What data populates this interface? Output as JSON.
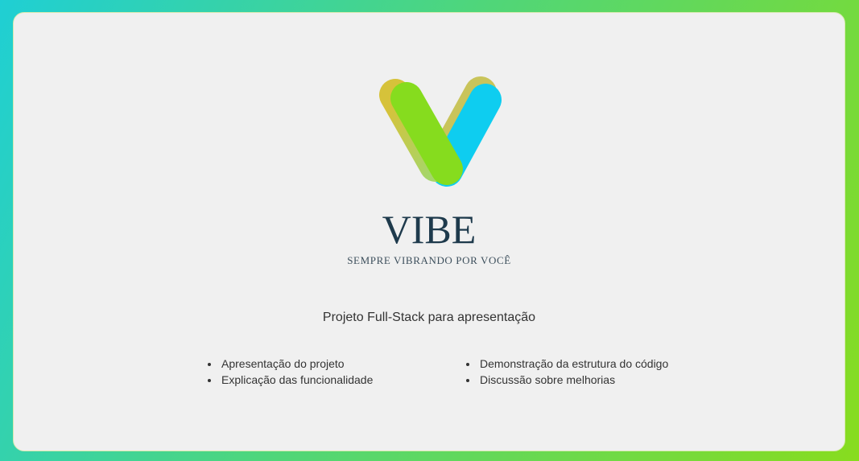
{
  "brand": {
    "name": "VIBE",
    "tagline": "SEMPRE VIBRANDO POR VOCÊ",
    "logo_colors": {
      "left_arm": "#86dc1e",
      "right_arm": "#0ecdf0",
      "shadow": "#d3c23a"
    }
  },
  "main": {
    "subtitle": "Projeto Full-Stack para apresentação",
    "agenda_left": [
      "Apresentação do projeto",
      "Explicação das funcionalidade"
    ],
    "agenda_right": [
      "Demonstração da estrutura do código",
      "Discussão sobre melhorias"
    ]
  },
  "colors": {
    "background_gradient_start": "#1fcfd4",
    "background_gradient_end": "#88dc1e",
    "card_background": "#f0f0f0",
    "brand_text": "#1e3a4c"
  }
}
